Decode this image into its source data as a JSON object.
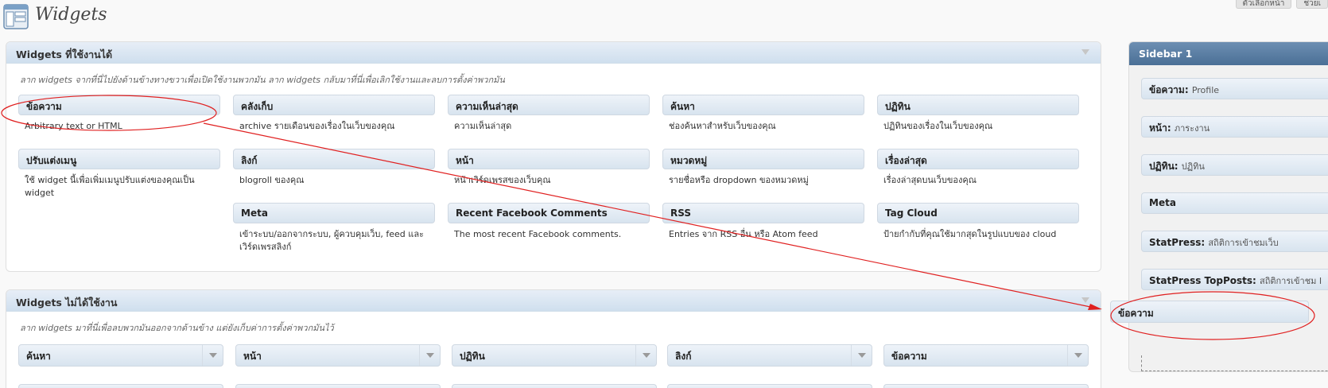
{
  "header": {
    "title": "Widgets",
    "top_links": [
      "ตัวเลือกหน้า",
      "ช่วยเ"
    ]
  },
  "available": {
    "title": "Widgets ที่ใช้งานได้",
    "description": "ลาก widgets จากที่นี่ไปยังด้านข้างทางขวาเพื่อเปิดใช้งานพวกมัน ลาก widgets กลับมาที่นี่เพื่อเลิกใช้งานและลบการตั้งค่าพวกมัน",
    "widgets": [
      {
        "title": "ข้อความ",
        "desc": "Arbitrary text or HTML"
      },
      {
        "title": "คลังเก็บ",
        "desc": "archive รายเดือนของเรื่องในเว็บของคุณ"
      },
      {
        "title": "ความเห็นล่าสุด",
        "desc": "ความเห็นล่าสุด"
      },
      {
        "title": "ค้นหา",
        "desc": "ช่องค้นหาสำหรับเว็บของคุณ"
      },
      {
        "title": "ปฏิทิน",
        "desc": "ปฏิทินของเรื่องในเว็บของคุณ"
      },
      {
        "title": "ปรับแต่งเมนู",
        "desc": "ใช้ widget นี้เพื่อเพิ่มเมนูปรับแต่งของคุณเป็น widget"
      },
      {
        "title": "ลิงก์",
        "desc": "blogroll ของคุณ"
      },
      {
        "title": "หน้า",
        "desc": "หน้าเวิร์ดเพรสของเว็บคุณ"
      },
      {
        "title": "หมวดหมู่",
        "desc": "รายชื่อหรือ dropdown ของหมวดหมู่"
      },
      {
        "title": "เรื่องล่าสุด",
        "desc": "เรื่องล่าสุดบนเว็บของคุณ"
      },
      {
        "title": "Meta",
        "desc": "เข้าระบบ/ออกจากระบบ, ผู้ควบคุมเว็บ, feed และเวิร์ดเพรสลิงก์"
      },
      {
        "title": "Recent Facebook Comments",
        "desc": "The most recent Facebook comments."
      },
      {
        "title": "RSS",
        "desc": "Entries จาก RSS อื่น หรือ Atom feed"
      },
      {
        "title": "Tag Cloud",
        "desc": "ป้ายกำกับที่คุณใช้มากสุดในรูปแบบของ cloud"
      }
    ]
  },
  "inactive": {
    "title": "Widgets ไม่ได้ใช้งาน",
    "description": "ลาก widgets มาที่นี่เพื่อลบพวกมันออกจากด้านข้าง แต่ยังเก็บค่าการตั้งค่าพวกมันไว้",
    "widgets": [
      "ค้นหา",
      "หน้า",
      "ปฏิทิน",
      "ลิงก์",
      "ข้อความ"
    ]
  },
  "sidebar": {
    "title": "Sidebar 1",
    "widgets": [
      {
        "title": "ข้อความ:",
        "sub": "Profile"
      },
      {
        "title": "หน้า:",
        "sub": "ภาระงาน"
      },
      {
        "title": "ปฏิทิน:",
        "sub": "ปฏิทิน"
      },
      {
        "title": "Meta",
        "sub": ""
      },
      {
        "title": "StatPress:",
        "sub": "สถิติการเข้าชมเว็บ"
      },
      {
        "title": "StatPress TopPosts:",
        "sub": "สถิติการเข้าชม I"
      }
    ],
    "dragging": "ข้อความ"
  },
  "colors": {
    "annotation": "#e02020",
    "sidebar_head": "#4a6f96"
  }
}
